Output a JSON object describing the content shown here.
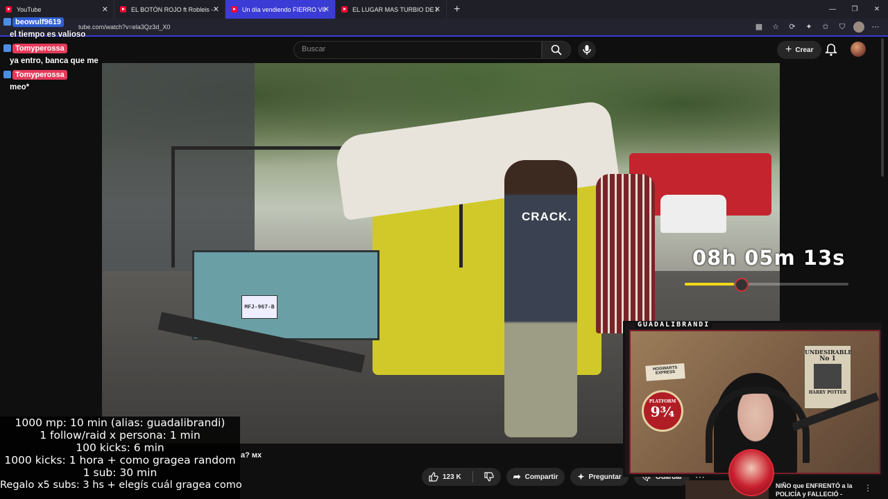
{
  "browser": {
    "tabs": [
      {
        "title": "YouTube",
        "active": false
      },
      {
        "title": "EL BOTÓN ROJO ft Robleis - YouTu",
        "active": false
      },
      {
        "title": "Un día vendiendo FIERRO VIEJO |",
        "active": true
      },
      {
        "title": "EL LUGAR MAS TURBIO DE BOLIVI",
        "active": false
      }
    ],
    "new_tab": "+",
    "close": "✕",
    "window_controls": [
      "—",
      "❐",
      "✕"
    ],
    "url": "tube.com/watch?v=ela3Qz3d_X0"
  },
  "youtube": {
    "search_placeholder": "Buscar",
    "create_label": "Crear",
    "video_title_fragment": "a? мх",
    "actions": {
      "likes": "123 K",
      "share": "Compartir",
      "ask": "Preguntar",
      "save": "Guardar",
      "more": "⋯"
    },
    "recommendation": {
      "title": "NIÑO que ENFRENTÓ a la POLICÍA y FALLECIÓ - Caso"
    }
  },
  "video": {
    "plate": "MFJ-967-B",
    "shirt": "CRACK."
  },
  "overlay": {
    "timer": "08h 05m 13s",
    "timer_progress": 0.3,
    "chat": [
      {
        "user": "beowulf9619",
        "message": "el tiempo es valioso",
        "color": "#2f5fd1"
      },
      {
        "user": "Tomyperossa",
        "message": "ya entro, banca que me",
        "color": "#e63a5a"
      },
      {
        "user": "Tomyperossa",
        "message": "meo*",
        "color": "#e63a5a"
      }
    ],
    "rules": [
      "1000 mp: 10 min (alias: guadalibrandi)",
      "1 follow/raid x persona: 1 min",
      "100 kicks: 6 min",
      "1000 kicks: 1 hora + como gragea random",
      "1 sub: 30 min",
      "Regalo x5 subs: 3 hs + elegís cuál gragea como"
    ],
    "streamer_name": "GUADALIBRANDI",
    "poster": {
      "top": "UNDESIRABLE",
      "no": "No 1",
      "name": "HARRY POTTER"
    },
    "platform": {
      "label": "PLATFORM",
      "number": "9¾"
    },
    "ticket": "HOGWARTS EXPRESS"
  },
  "colors": {
    "accent": "#3b3bd6",
    "youtube_bg": "#0f0f0f",
    "timer_bar": "#f0d81c"
  }
}
